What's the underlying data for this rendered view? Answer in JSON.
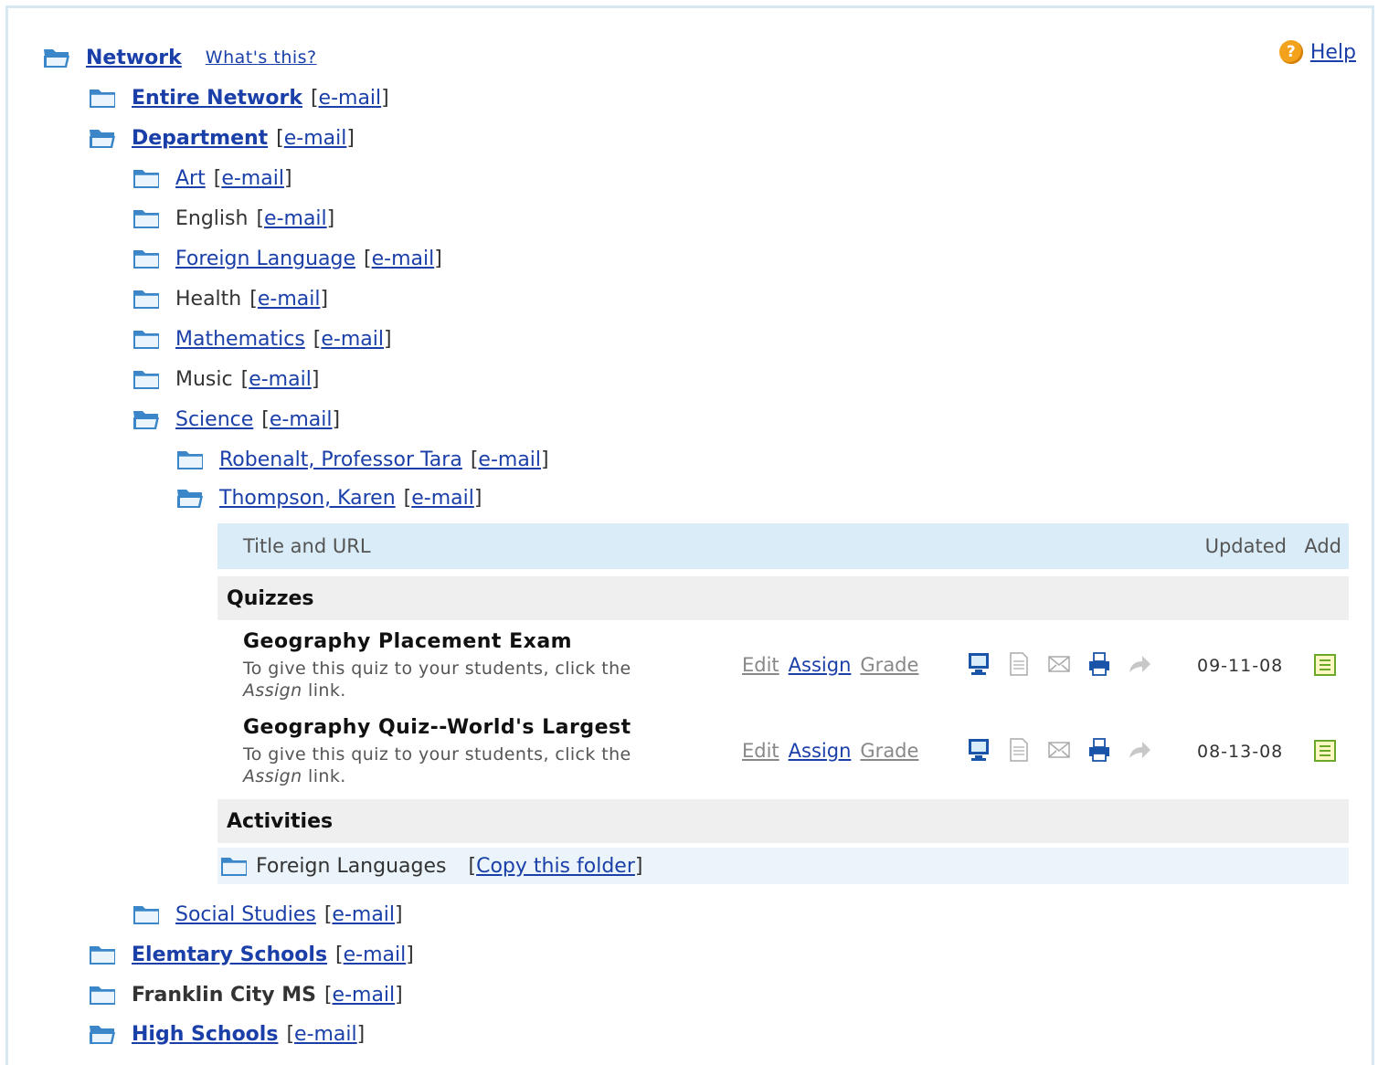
{
  "header": {
    "network_label": "Network",
    "whats_this": "What's this?",
    "help_label": "Help",
    "help_glyph": "?"
  },
  "email_label": "e-mail",
  "tree": {
    "entire_network": "Entire Network",
    "department": "Department",
    "art": "Art",
    "english": "English",
    "foreign_language": "Foreign Language",
    "health": "Health",
    "mathematics": "Mathematics",
    "music": "Music",
    "science": "Science",
    "robenalt": "Robenalt, Professor Tara",
    "thompson": "Thompson, Karen",
    "social_studies": "Social Studies",
    "elementary_schools": "Elemtary Schools",
    "franklin": "Franklin City MS",
    "high_schools": "High Schools"
  },
  "table": {
    "col_title": "Title and URL",
    "col_updated": "Updated",
    "col_add": "Add",
    "section_quizzes": "Quizzes",
    "section_activities": "Activities",
    "quizzes": [
      {
        "title": "Geography Placement Exam",
        "desc_line1": "To give this quiz to your students, click the",
        "desc_assign": "Assign",
        "desc_link": " link.",
        "edit": "Edit",
        "assign": "Assign",
        "grade": "Grade",
        "date": "09-11-08"
      },
      {
        "title": "Geography Quiz--World's Largest",
        "desc_line1": "To give this quiz to your students, click the",
        "desc_assign": "Assign",
        "desc_link": " link.",
        "edit": "Edit",
        "assign": "Assign",
        "grade": "Grade",
        "date": "08-13-08"
      }
    ],
    "activity_folder": "Foreign Languages",
    "copy_folder": "Copy this folder"
  },
  "colors": {
    "link": "#1a3fa8",
    "header_bg": "#d9ecf7",
    "section_bg": "#efefef",
    "help_icon": "#f3a21c"
  }
}
